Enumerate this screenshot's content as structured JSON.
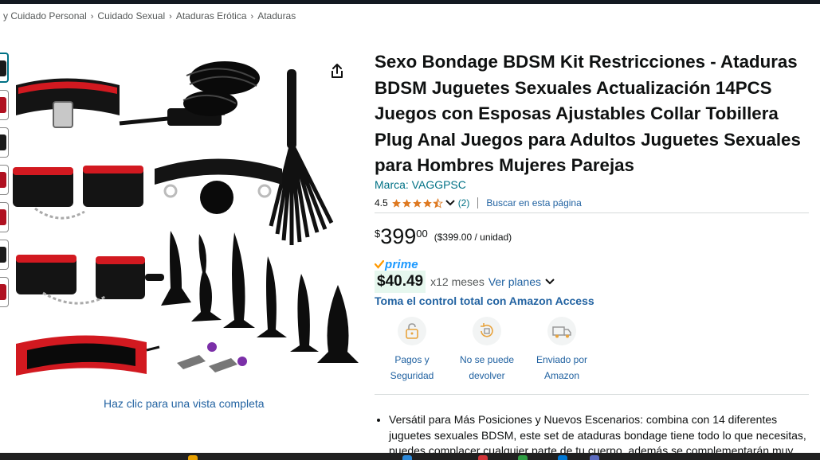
{
  "breadcrumb": [
    "y Cuidado Personal",
    "Cuidado Sexual",
    "Ataduras Erótica",
    "Ataduras"
  ],
  "breadcrumb_separator": "›",
  "product": {
    "title": "Sexo Bondage BDSM Kit Restricciones - Ataduras BDSM Juguetes Sexuales Actualización 14PCS Juegos con Esposas Ajustables Collar Tobillera Plug Anal Juegos para Adultos Juguetes Sexuales para Hombres Mujeres Parejas",
    "brand": "Marca: VAGGPSC",
    "rating": "4.5",
    "rating_stars": 4.5,
    "review_count": "(2)",
    "search_page": "Buscar en esta página"
  },
  "price": {
    "symbol": "$",
    "whole": "399",
    "fraction": "00",
    "unit_price": "($399.00 / unidad)"
  },
  "prime": {
    "label": "prime"
  },
  "installment": {
    "amount": "$40.49",
    "months": "x12 meses",
    "plans_link": "Ver planes"
  },
  "access_link": "Toma el control total con Amazon Access",
  "features": [
    {
      "icon": "secure-payment-icon",
      "label": "Pagos y Seguridad"
    },
    {
      "icon": "no-return-icon",
      "label": "No se puede devolver"
    },
    {
      "icon": "delivery-truck-icon",
      "label": "Enviado por Amazon"
    }
  ],
  "image": {
    "view_full": "Haz clic para una vista completa"
  },
  "bullets": [
    "Versátil para Más Posiciones y Nuevos Escenarios: combina con 14 diferentes juguetes sexuales BDSM, este set de ataduras bondage tiene todo lo que necesitas, puedes complacer cualquier parte de tu cuerpo, además se complementarán muy"
  ],
  "colors": {
    "link": "#2162a1",
    "teal_link": "#007185",
    "star": "#de7921",
    "prime_blue": "#1a98ff",
    "installment_bg": "#e6f7ee"
  }
}
